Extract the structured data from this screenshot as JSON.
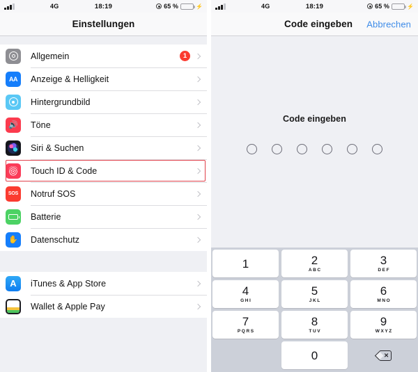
{
  "status_bar": {
    "carrier": "4G",
    "time": "18:19",
    "battery_percent": "65 %",
    "signal_bars_filled": 3,
    "signal_bars_total": 4
  },
  "left_screen": {
    "nav_title": "Einstellungen",
    "highlighted_row_index": 5,
    "groups": [
      {
        "rows": [
          {
            "label": "Allgemein",
            "icon": "gear-icon",
            "badge": "1"
          },
          {
            "label": "Anzeige & Helligkeit",
            "icon": "display-icon",
            "badge": ""
          },
          {
            "label": "Hintergrundbild",
            "icon": "wallpaper-icon",
            "badge": ""
          },
          {
            "label": "Töne",
            "icon": "sounds-icon",
            "badge": ""
          },
          {
            "label": "Siri & Suchen",
            "icon": "siri-icon",
            "badge": ""
          },
          {
            "label": "Touch ID & Code",
            "icon": "touchid-icon",
            "badge": ""
          },
          {
            "label": "Notruf SOS",
            "icon": "sos-icon",
            "badge": ""
          },
          {
            "label": "Batterie",
            "icon": "battery-icon",
            "badge": ""
          },
          {
            "label": "Datenschutz",
            "icon": "privacy-icon",
            "badge": ""
          }
        ]
      },
      {
        "rows": [
          {
            "label": "iTunes & App Store",
            "icon": "appstore-icon",
            "badge": ""
          },
          {
            "label": "Wallet & Apple Pay",
            "icon": "wallet-icon",
            "badge": ""
          }
        ]
      }
    ]
  },
  "right_screen": {
    "nav_title": "Code eingeben",
    "nav_action": "Abbrechen",
    "prompt": "Code eingeben",
    "passcode_dots": 6,
    "passcode_filled": 0,
    "keypad": [
      [
        {
          "num": "1",
          "letters": ""
        },
        {
          "num": "2",
          "letters": "ABC"
        },
        {
          "num": "3",
          "letters": "DEF"
        }
      ],
      [
        {
          "num": "4",
          "letters": "GHI"
        },
        {
          "num": "5",
          "letters": "JKL"
        },
        {
          "num": "6",
          "letters": "MNO"
        }
      ],
      [
        {
          "num": "7",
          "letters": "PQRS"
        },
        {
          "num": "8",
          "letters": "TUV"
        },
        {
          "num": "9",
          "letters": "WXYZ"
        }
      ]
    ],
    "zero_key": {
      "num": "0",
      "letters": ""
    },
    "delete_key_name": "delete-icon"
  },
  "colors": {
    "accent_link": "#3f8ce8",
    "highlight_border": "#e0404a",
    "badge_red": "#fb3b30",
    "battery_green": "#4cd364",
    "keypad_bg": "#ccd0d9",
    "panel_bg": "#eff0f4"
  }
}
